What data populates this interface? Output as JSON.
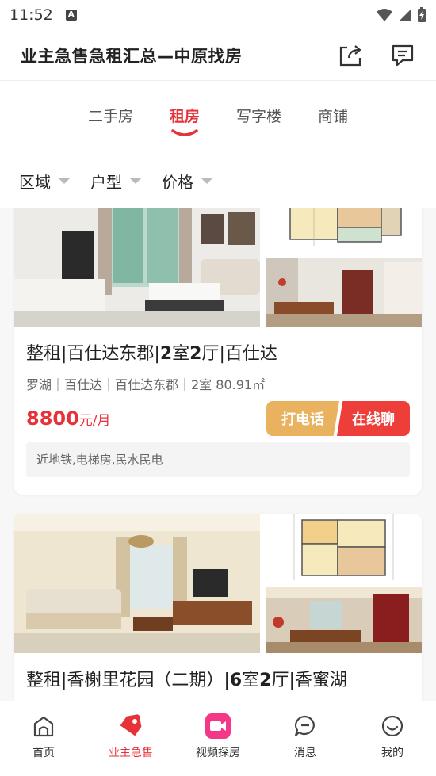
{
  "status_bar": {
    "time": "11:52",
    "notification_letter": "A"
  },
  "header": {
    "title": "业主急售急租汇总—中原找房"
  },
  "tabs": [
    {
      "label": "二手房",
      "active": false
    },
    {
      "label": "租房",
      "active": true
    },
    {
      "label": "写字楼",
      "active": false
    },
    {
      "label": "商铺",
      "active": false
    }
  ],
  "filters": [
    {
      "label": "区域"
    },
    {
      "label": "户型"
    },
    {
      "label": "价格"
    }
  ],
  "listings": [
    {
      "title_prefix": "整租|百仕达东郡|",
      "title_rooms": "2",
      "title_room_unit": "室",
      "title_halls": "2",
      "title_hall_unit": "厅",
      "title_suffix": "|百仕达",
      "meta": "罗湖｜百仕达｜百仕达东郡｜2室  80.91㎡",
      "price": "8800",
      "price_unit": "元/月",
      "call_label": "打电话",
      "chat_label": "在线聊",
      "tags": "近地铁,电梯房,民水民电"
    },
    {
      "title_prefix": "整租|香榭里花园（二期）|",
      "title_rooms": "6",
      "title_room_unit": "室",
      "title_halls": "2",
      "title_hall_unit": "厅",
      "title_suffix": "|香蜜湖"
    }
  ],
  "bottom_nav": [
    {
      "label": "首页",
      "icon": "home-icon",
      "active": false
    },
    {
      "label": "业主急售",
      "icon": "price-tag-icon",
      "active": true
    },
    {
      "label": "视频探房",
      "icon": "video-icon",
      "active": false
    },
    {
      "label": "消息",
      "icon": "message-icon",
      "active": false
    },
    {
      "label": "我的",
      "icon": "profile-icon",
      "active": false
    }
  ],
  "colors": {
    "accent": "#e8323a",
    "call_button": "#e8b25e",
    "chat_button": "#ee3e3a"
  }
}
